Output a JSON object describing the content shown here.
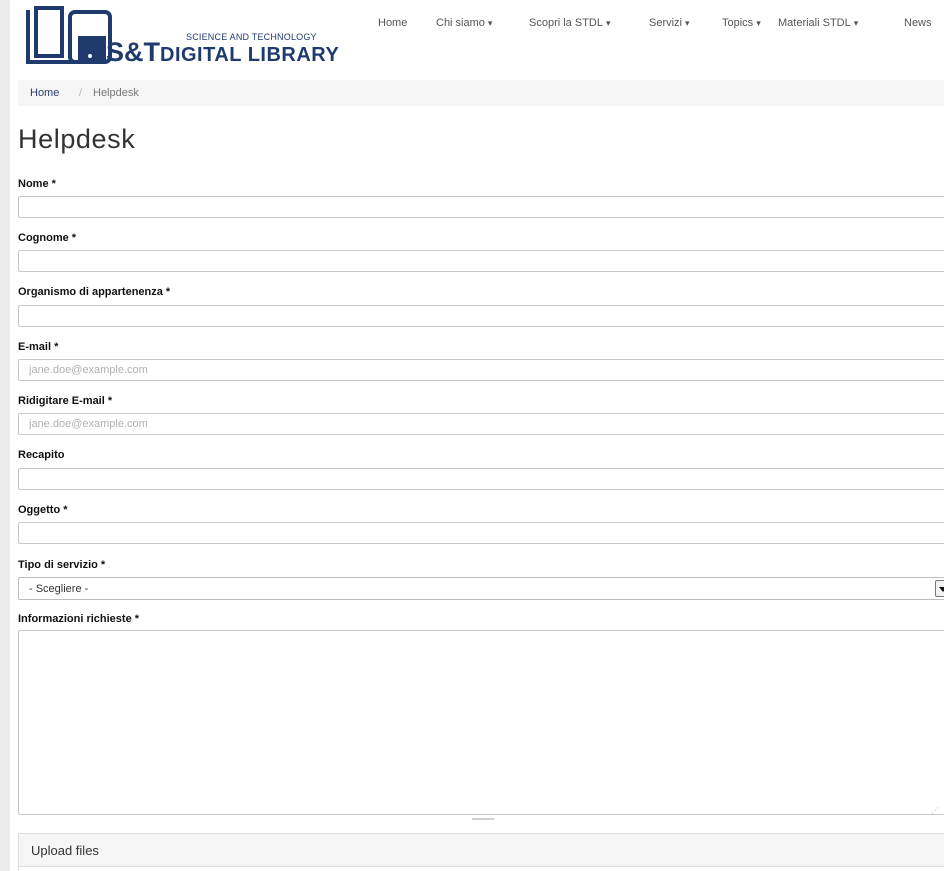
{
  "logo": {
    "line_small": "SCIENCE AND TECHNOLOGY",
    "line_brand": "S&T",
    "line_big": "DIGITAL LIBRARY"
  },
  "nav": {
    "items": [
      {
        "label": "Home",
        "caret": ""
      },
      {
        "label": "Chi siamo",
        "caret": "▾"
      },
      {
        "label": "Scopri la STDL",
        "caret": "▾"
      },
      {
        "label": "Servizi",
        "caret": "▾"
      },
      {
        "label": "Topics",
        "caret": "▾"
      },
      {
        "label": "Materiali STDL",
        "caret": "▾"
      },
      {
        "label": "News",
        "caret": ""
      }
    ]
  },
  "breadcrumb": {
    "home": "Home",
    "separator": "/",
    "current": "Helpdesk"
  },
  "page_title": "Helpdesk",
  "form": {
    "nome": {
      "label": "Nome *",
      "value": "",
      "placeholder": ""
    },
    "cognome": {
      "label": "Cognome *",
      "value": "",
      "placeholder": ""
    },
    "organismo": {
      "label": "Organismo di appartenenza *",
      "value": "",
      "placeholder": ""
    },
    "email": {
      "label": "E-mail *",
      "value": "",
      "placeholder": "jane.doe@example.com"
    },
    "email_confirm": {
      "label": "Ridigitare E-mail *",
      "value": "",
      "placeholder": "jane.doe@example.com"
    },
    "recapito": {
      "label": "Recapito",
      "value": "",
      "placeholder": ""
    },
    "oggetto": {
      "label": "Oggetto *",
      "value": "",
      "placeholder": ""
    },
    "tipo_servizio": {
      "label": "Tipo di servizio *",
      "selected": "- Scegliere -"
    },
    "informazioni": {
      "label": "Informazioni richieste *",
      "value": ""
    }
  },
  "upload": {
    "title": "Upload files"
  },
  "colors": {
    "brand_navy": "#1f3b6e",
    "link": "#2a3f6a",
    "breadcrumb_bg": "#f5f5f5"
  }
}
